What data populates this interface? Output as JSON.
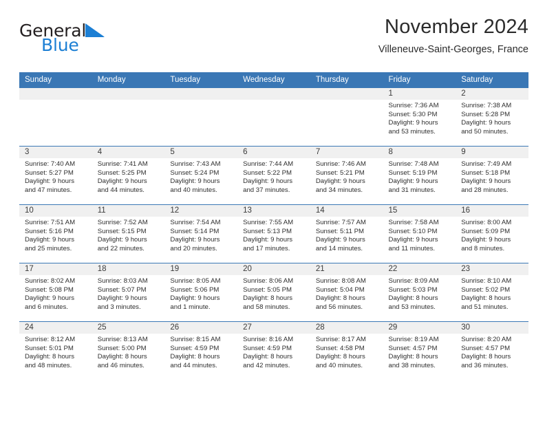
{
  "brand": {
    "name_part1": "General",
    "name_part2": "Blue",
    "logo_icon": "triangle-logo-icon",
    "accent_color": "#1c7fd4"
  },
  "header": {
    "title": "November 2024",
    "subtitle": "Villeneuve-Saint-Georges, France"
  },
  "theme": {
    "header_blue": "#3a77b5",
    "daynum_gray": "#f0f0f0",
    "text": "#2e2e2e"
  },
  "calendar": {
    "weekday_headers": [
      "Sunday",
      "Monday",
      "Tuesday",
      "Wednesday",
      "Thursday",
      "Friday",
      "Saturday"
    ],
    "weeks": [
      [
        {
          "day": "",
          "lines": []
        },
        {
          "day": "",
          "lines": []
        },
        {
          "day": "",
          "lines": []
        },
        {
          "day": "",
          "lines": []
        },
        {
          "day": "",
          "lines": []
        },
        {
          "day": "1",
          "lines": [
            "Sunrise: 7:36 AM",
            "Sunset: 5:30 PM",
            "Daylight: 9 hours",
            "and 53 minutes."
          ]
        },
        {
          "day": "2",
          "lines": [
            "Sunrise: 7:38 AM",
            "Sunset: 5:28 PM",
            "Daylight: 9 hours",
            "and 50 minutes."
          ]
        }
      ],
      [
        {
          "day": "3",
          "lines": [
            "Sunrise: 7:40 AM",
            "Sunset: 5:27 PM",
            "Daylight: 9 hours",
            "and 47 minutes."
          ]
        },
        {
          "day": "4",
          "lines": [
            "Sunrise: 7:41 AM",
            "Sunset: 5:25 PM",
            "Daylight: 9 hours",
            "and 44 minutes."
          ]
        },
        {
          "day": "5",
          "lines": [
            "Sunrise: 7:43 AM",
            "Sunset: 5:24 PM",
            "Daylight: 9 hours",
            "and 40 minutes."
          ]
        },
        {
          "day": "6",
          "lines": [
            "Sunrise: 7:44 AM",
            "Sunset: 5:22 PM",
            "Daylight: 9 hours",
            "and 37 minutes."
          ]
        },
        {
          "day": "7",
          "lines": [
            "Sunrise: 7:46 AM",
            "Sunset: 5:21 PM",
            "Daylight: 9 hours",
            "and 34 minutes."
          ]
        },
        {
          "day": "8",
          "lines": [
            "Sunrise: 7:48 AM",
            "Sunset: 5:19 PM",
            "Daylight: 9 hours",
            "and 31 minutes."
          ]
        },
        {
          "day": "9",
          "lines": [
            "Sunrise: 7:49 AM",
            "Sunset: 5:18 PM",
            "Daylight: 9 hours",
            "and 28 minutes."
          ]
        }
      ],
      [
        {
          "day": "10",
          "lines": [
            "Sunrise: 7:51 AM",
            "Sunset: 5:16 PM",
            "Daylight: 9 hours",
            "and 25 minutes."
          ]
        },
        {
          "day": "11",
          "lines": [
            "Sunrise: 7:52 AM",
            "Sunset: 5:15 PM",
            "Daylight: 9 hours",
            "and 22 minutes."
          ]
        },
        {
          "day": "12",
          "lines": [
            "Sunrise: 7:54 AM",
            "Sunset: 5:14 PM",
            "Daylight: 9 hours",
            "and 20 minutes."
          ]
        },
        {
          "day": "13",
          "lines": [
            "Sunrise: 7:55 AM",
            "Sunset: 5:13 PM",
            "Daylight: 9 hours",
            "and 17 minutes."
          ]
        },
        {
          "day": "14",
          "lines": [
            "Sunrise: 7:57 AM",
            "Sunset: 5:11 PM",
            "Daylight: 9 hours",
            "and 14 minutes."
          ]
        },
        {
          "day": "15",
          "lines": [
            "Sunrise: 7:58 AM",
            "Sunset: 5:10 PM",
            "Daylight: 9 hours",
            "and 11 minutes."
          ]
        },
        {
          "day": "16",
          "lines": [
            "Sunrise: 8:00 AM",
            "Sunset: 5:09 PM",
            "Daylight: 9 hours",
            "and 8 minutes."
          ]
        }
      ],
      [
        {
          "day": "17",
          "lines": [
            "Sunrise: 8:02 AM",
            "Sunset: 5:08 PM",
            "Daylight: 9 hours",
            "and 6 minutes."
          ]
        },
        {
          "day": "18",
          "lines": [
            "Sunrise: 8:03 AM",
            "Sunset: 5:07 PM",
            "Daylight: 9 hours",
            "and 3 minutes."
          ]
        },
        {
          "day": "19",
          "lines": [
            "Sunrise: 8:05 AM",
            "Sunset: 5:06 PM",
            "Daylight: 9 hours",
            "and 1 minute."
          ]
        },
        {
          "day": "20",
          "lines": [
            "Sunrise: 8:06 AM",
            "Sunset: 5:05 PM",
            "Daylight: 8 hours",
            "and 58 minutes."
          ]
        },
        {
          "day": "21",
          "lines": [
            "Sunrise: 8:08 AM",
            "Sunset: 5:04 PM",
            "Daylight: 8 hours",
            "and 56 minutes."
          ]
        },
        {
          "day": "22",
          "lines": [
            "Sunrise: 8:09 AM",
            "Sunset: 5:03 PM",
            "Daylight: 8 hours",
            "and 53 minutes."
          ]
        },
        {
          "day": "23",
          "lines": [
            "Sunrise: 8:10 AM",
            "Sunset: 5:02 PM",
            "Daylight: 8 hours",
            "and 51 minutes."
          ]
        }
      ],
      [
        {
          "day": "24",
          "lines": [
            "Sunrise: 8:12 AM",
            "Sunset: 5:01 PM",
            "Daylight: 8 hours",
            "and 48 minutes."
          ]
        },
        {
          "day": "25",
          "lines": [
            "Sunrise: 8:13 AM",
            "Sunset: 5:00 PM",
            "Daylight: 8 hours",
            "and 46 minutes."
          ]
        },
        {
          "day": "26",
          "lines": [
            "Sunrise: 8:15 AM",
            "Sunset: 4:59 PM",
            "Daylight: 8 hours",
            "and 44 minutes."
          ]
        },
        {
          "day": "27",
          "lines": [
            "Sunrise: 8:16 AM",
            "Sunset: 4:59 PM",
            "Daylight: 8 hours",
            "and 42 minutes."
          ]
        },
        {
          "day": "28",
          "lines": [
            "Sunrise: 8:17 AM",
            "Sunset: 4:58 PM",
            "Daylight: 8 hours",
            "and 40 minutes."
          ]
        },
        {
          "day": "29",
          "lines": [
            "Sunrise: 8:19 AM",
            "Sunset: 4:57 PM",
            "Daylight: 8 hours",
            "and 38 minutes."
          ]
        },
        {
          "day": "30",
          "lines": [
            "Sunrise: 8:20 AM",
            "Sunset: 4:57 PM",
            "Daylight: 8 hours",
            "and 36 minutes."
          ]
        }
      ]
    ]
  }
}
